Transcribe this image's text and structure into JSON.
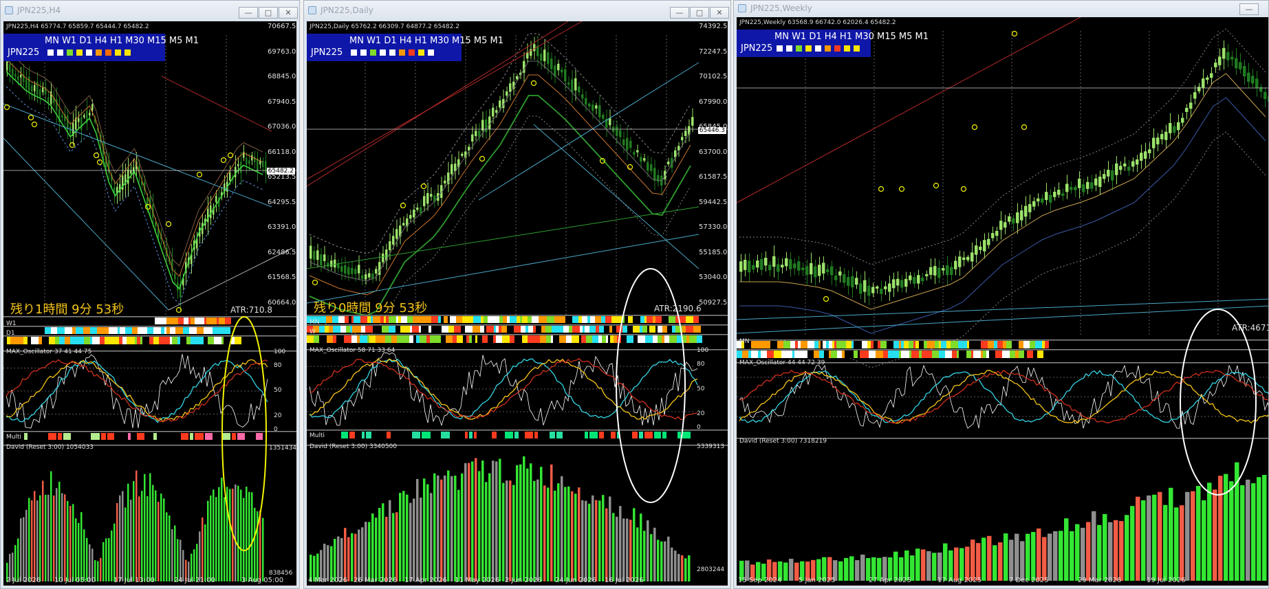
{
  "windows": [
    {
      "id": "h4",
      "title": "JPN225,H4",
      "header": "JPN225,H4  65774.7 65859.7 65444.7 65482.2",
      "symbol": "JPN225",
      "timeframes": "MN W1 D1 H4 H1 M30 M15 M5 M1",
      "tf_colors": [
        "#ffffff",
        "#ffffff",
        "#7fdc2a",
        "#ffe600",
        "#ffffff",
        "#ff9900",
        "#ff6a00",
        "#ffe600",
        "#ffe600"
      ],
      "price_axis": [
        "70667.5",
        "69763.0",
        "68845.0",
        "67940.5",
        "67036.0",
        "66118.0",
        "65213.5",
        "64295.5",
        "63391.0",
        "62486.5",
        "61568.5",
        "60664.0"
      ],
      "current_price": "65482.2",
      "timer": "残り1時間 9分 53秒",
      "atr": "ATR:710.8",
      "strip_labels": [
        "W1",
        "D1",
        ""
      ],
      "oscillator_label": "MAX_Oscillator 37 41 44 75",
      "osc_levels": [
        "100",
        "80",
        "50",
        "20",
        "0"
      ],
      "multi_label": "Multi",
      "david_label": "David (Reset 3:00) 1054033",
      "david_axis": [
        "1351434",
        "838456"
      ],
      "dates": [
        "2 Jul 2026",
        "10 Jul 05:00",
        "17 Jul 13:00",
        "24 Jul 21:00",
        "3 Aug 05:00"
      ]
    },
    {
      "id": "daily",
      "title": "JPN225,Daily",
      "header": "JPN225,Daily  65762.2 66309.7 64877.2 65482.2",
      "symbol": "JPN225",
      "timeframes": "MN W1 D1 H4 H1 M30 M15 M5 M1",
      "tf_colors": [
        "#ffffff",
        "#ffffff",
        "#7fdc2a",
        "#ffffff",
        "#ffffff",
        "#ff9900",
        "#ff3b1f",
        "#ffe600",
        "#ffffff"
      ],
      "price_axis": [
        "74392.5",
        "72247.5",
        "70102.5",
        "67990.0",
        "65845.0",
        "63700.0",
        "61587.5",
        "59442.5",
        "57330.0",
        "55185.0",
        "53040.0",
        "50927.5"
      ],
      "current_price": "65446.3",
      "timer": "残り0時間 9分 53秒",
      "atr": "ATR:2190.6",
      "strip_labels": [
        "MN",
        "W",
        ""
      ],
      "oscillator_label": "MAX_Oscillator 58 71 33 64",
      "osc_levels": [
        "100",
        "80",
        "50",
        "20",
        "0"
      ],
      "multi_label": "Multi",
      "david_label": "David (Reset 3:00) 3340500",
      "david_axis": [
        "5339313",
        "2803244"
      ],
      "dates": [
        "4 Mar 2026",
        "26 Mar 2026",
        "17 Apr 2026",
        "11 May 2026",
        "2 Jun 2026",
        "24 Jun 2026",
        "16 Jul 2026"
      ]
    },
    {
      "id": "weekly",
      "title": "JPN225,Weekly",
      "header": "JPN225,Weekly  63568.9 66742.0 62026.4 65482.2",
      "symbol": "JPN225",
      "timeframes": "MN W1 D1 H4 H1 M30 M15 M5 M1",
      "tf_colors": [
        "#ffffff",
        "#ffffff",
        "#7fdc2a",
        "#ffe600",
        "#ffffff",
        "#ff9900",
        "#ff3b1f",
        "#ffe600",
        "#ffe600"
      ],
      "atr": "ATR:4671.5",
      "strip_labels": [
        "MN",
        ""
      ],
      "oscillator_label": "MAX_Oscillator 44 44 72 39",
      "david_label": "David (Reset 3:00) 7318219",
      "dates": [
        "15 Sep 2024",
        "5 Jan 2025",
        "27 Apr 2025",
        "17 Aug 2025",
        "7 Dec 2025",
        "29 Mar 2026",
        "19 Jul 2026"
      ]
    }
  ],
  "colors": {
    "bull": "#9be26a",
    "bear": "#1f7a1f",
    "hist_green": "#33e633",
    "hist_gray": "#8f8f8f",
    "hist_red": "#f25c45",
    "annot_yellow": "#f5f500",
    "annot_white": "#ffffff"
  }
}
